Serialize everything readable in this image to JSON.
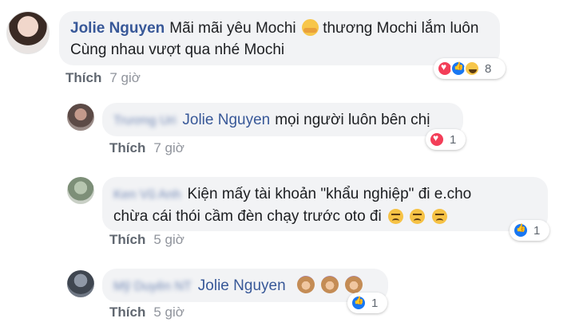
{
  "comments": [
    {
      "author": "Jolie Nguyen",
      "text_line1": "Mãi mãi yêu Mochi",
      "text_line1b": "thương Mochi lắm luôn",
      "text_line2": "Cùng nhau vượt qua nhé Mochi",
      "like_label": "Thích",
      "time": "7 giờ",
      "reaction_icons": [
        "heart-icon",
        "like-icon",
        "haha-icon"
      ],
      "reaction_count": "8"
    },
    {
      "author": "Trương Uri",
      "tag": "Jolie Nguyen",
      "text": "mọi người luôn bên chị",
      "like_label": "Thích",
      "time": "7 giờ",
      "reaction_icons": [
        "heart-icon"
      ],
      "reaction_count": "1"
    },
    {
      "author": "Ken Vũ Anh",
      "text_line1": "Kiện mấy tài khoản \"khẩu nghiệp\" đi e.cho",
      "text_line2": "chừa cái thói cầm đèn chạy trước oto đi",
      "like_label": "Thích",
      "time": "5 giờ",
      "reaction_icons": [
        "like-icon"
      ],
      "reaction_count": "1"
    },
    {
      "author": "Mỹ Duyên NT",
      "tag": "Jolie Nguyen",
      "like_label": "Thích",
      "time": "5 giờ",
      "reaction_icons": [
        "like-icon"
      ],
      "reaction_count": "1"
    }
  ],
  "colors": {
    "name_blue": "#385898",
    "bubble_bg": "#f2f3f5",
    "meta_gray": "#90949c",
    "heart_red": "#f33e58",
    "like_blue": "#1877f2"
  }
}
